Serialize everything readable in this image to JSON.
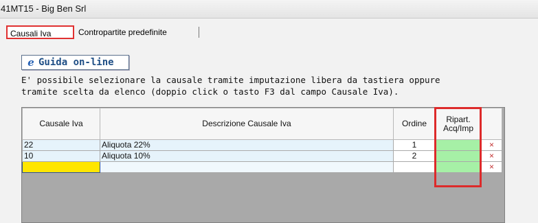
{
  "window": {
    "title": "41MT15 - Big Ben Srl"
  },
  "tabs": [
    {
      "label": "Causali Iva",
      "active": true
    },
    {
      "label": "Contropartite predefinite",
      "active": false
    }
  ],
  "help_button": {
    "label": "Guida on-line",
    "icon": "ie-icon"
  },
  "info_text": {
    "line1": "E' possibile selezionare la causale tramite imputazione libera da tastiera oppure",
    "line2": "tramite scelta da elenco (doppio click o tasto F3 dal campo Causale Iva)."
  },
  "grid": {
    "columns": {
      "causale": "Causale Iva",
      "descrizione": "Descrizione Causale Iva",
      "ordine": "Ordine",
      "ripart_line1": "Ripart.",
      "ripart_line2": "Acq/Imp"
    },
    "rows": [
      {
        "causale": "22",
        "descrizione": "Aliquota 22%",
        "ordine": "1",
        "delete": "×"
      },
      {
        "causale": "10",
        "descrizione": "Aliquota 10%",
        "ordine": "2",
        "delete": "×"
      },
      {
        "causale": "",
        "descrizione": "",
        "ordine": "",
        "delete": "×"
      }
    ]
  },
  "colors": {
    "active_tab_highlight": "#e03030",
    "ripart_highlight": "#dd2a2a",
    "ripart_cell": "#a6f0a6",
    "new_row_cell": "#ffe600",
    "delete_icon": "#c23030"
  }
}
